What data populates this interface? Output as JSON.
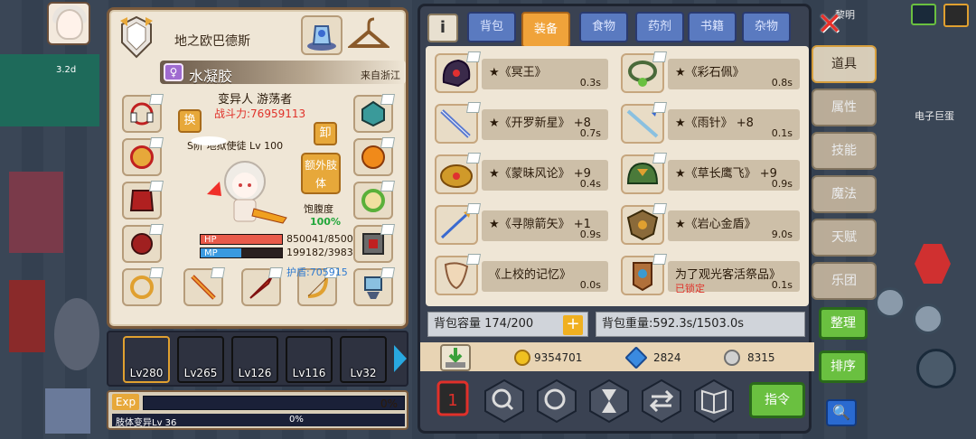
{
  "hud": {
    "level_badge": "3.2d",
    "top_right_text": "黎明",
    "npc_label": "电子巨蛋"
  },
  "character": {
    "name": "地之欧巴德斯",
    "title": "水凝胶",
    "title_icon": "♀",
    "origin": "来自浙江",
    "class": "变异人 游荡者",
    "power": "战斗力:76959113",
    "level_line": "S阶 地狱使徒 Lv 100",
    "swap_label": "换",
    "unequip_label": "卸",
    "extra_limb_label": "额外肢体",
    "hunger_label": "饱腹度",
    "hunger_value": "100%",
    "hp_label": "HP",
    "hp_value": "850041/8500",
    "hp_fraction": 1.0,
    "mp_label": "MP",
    "mp_value": "199182/3983",
    "mp_fraction": 0.5,
    "shield": "护盾:705915"
  },
  "companions": [
    {
      "level": "Lv280",
      "color": "#d99a2a"
    },
    {
      "level": "Lv265",
      "color": "#3a5a8a"
    },
    {
      "level": "Lv126",
      "color": "#6a6a6a"
    },
    {
      "level": "Lv116",
      "color": "#6a6a6a"
    },
    {
      "level": "Lv32",
      "color": "#5a5a5a"
    }
  ],
  "exp": {
    "label": "Exp",
    "percent": "0%",
    "mutation_label": "肢体变异Lv 36",
    "mutation_percent": "0%"
  },
  "inventory": {
    "info_icon": "i",
    "tabs": [
      {
        "label": "背包",
        "active": false
      },
      {
        "label": "装备",
        "active": true
      },
      {
        "label": "食物",
        "active": false
      },
      {
        "label": "药剂",
        "active": false
      },
      {
        "label": "书籍",
        "active": false
      },
      {
        "label": "杂物",
        "active": false
      }
    ],
    "items": [
      {
        "name": "★《冥王》",
        "time": "0.3s",
        "lock": "",
        "icon": "dark-helm-icon",
        "color": "#3a2a4a"
      },
      {
        "name": "★《彩石佩》",
        "time": "0.8s",
        "lock": "",
        "icon": "necklace-icon",
        "color": "#4a6a3a"
      },
      {
        "name": "★《开罗新星》 +8",
        "time": "0.7s",
        "lock": "",
        "icon": "sword-icon",
        "color": "#5a7ad0"
      },
      {
        "name": "★《雨针》 +8",
        "time": "0.1s",
        "lock": "",
        "icon": "spear-icon",
        "color": "#8ac0e0"
      },
      {
        "name": "★《蒙昧风论》 +9",
        "time": "0.4s",
        "lock": "",
        "icon": "crown-icon",
        "color": "#d09a2a"
      },
      {
        "name": "★《草长鹰飞》 +9",
        "time": "0.9s",
        "lock": "",
        "icon": "eagle-helm-icon",
        "color": "#4a7a3a"
      },
      {
        "name": "★《寻隙箭矢》 +1",
        "time": "0.9s",
        "lock": "",
        "icon": "arrow-icon",
        "color": "#3a6ad0"
      },
      {
        "name": "★《岩心金盾》",
        "time": "9.0s",
        "lock": "",
        "icon": "shield-icon",
        "color": "#8a6a3a"
      },
      {
        "name": "《上校的记忆》",
        "time": "0.0s",
        "lock": "",
        "icon": "scroll-icon",
        "color": "#c08a5a"
      },
      {
        "name": "为了观光客活祭品》",
        "time": "0.1s",
        "lock": "已锁定",
        "icon": "amulet-icon",
        "color": "#b0703a"
      }
    ],
    "capacity": "背包容量 174/200",
    "weight": "背包重量:592.3s/1503.0s",
    "gold": "9354701",
    "diamond": "2824",
    "silver": "8315",
    "command_label": "指令"
  },
  "side_tabs": [
    {
      "label": "道具",
      "active": true
    },
    {
      "label": "属性",
      "active": false
    },
    {
      "label": "技能",
      "active": false
    },
    {
      "label": "魔法",
      "active": false
    },
    {
      "label": "天赋",
      "active": false
    },
    {
      "label": "乐团",
      "active": false
    }
  ],
  "actions": {
    "organize": "整理",
    "sort": "排序",
    "close": "✕",
    "search": "🔍"
  }
}
